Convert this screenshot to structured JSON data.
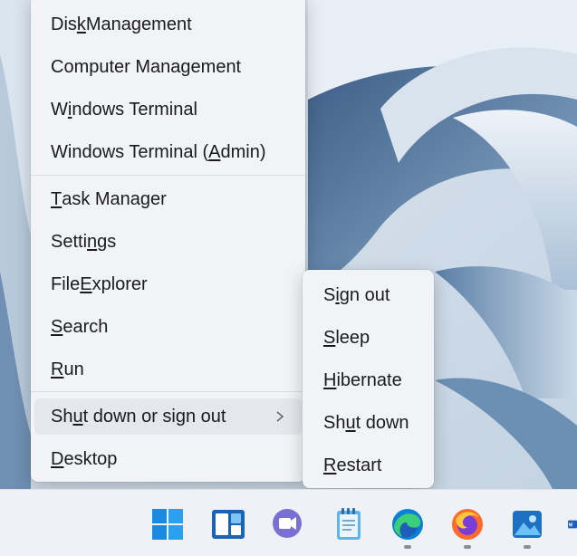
{
  "context_menu": {
    "items": [
      {
        "pre": "Dis",
        "u": "k",
        "post": " Management"
      },
      {
        "pre": "Computer Mana",
        "u": "g",
        "post": "ement"
      },
      {
        "pre": "W",
        "u": "i",
        "post": "ndows Terminal"
      },
      {
        "pre": "Windows Terminal (",
        "u": "A",
        "post": "dmin)"
      },
      {
        "pre": "",
        "u": "T",
        "post": "ask Manager"
      },
      {
        "pre": "Setti",
        "u": "n",
        "post": "gs"
      },
      {
        "pre": "File ",
        "u": "E",
        "post": "xplorer"
      },
      {
        "pre": "",
        "u": "S",
        "post": "earch"
      },
      {
        "pre": "",
        "u": "R",
        "post": "un"
      },
      {
        "pre": "Sh",
        "u": "u",
        "post": "t down or sign out"
      },
      {
        "pre": "",
        "u": "D",
        "post": "esktop"
      }
    ]
  },
  "submenu": {
    "items": [
      {
        "pre": "S",
        "u": "i",
        "post": "gn out"
      },
      {
        "pre": "",
        "u": "S",
        "post": "leep"
      },
      {
        "pre": "",
        "u": "H",
        "post": "ibernate"
      },
      {
        "pre": "Sh",
        "u": "u",
        "post": "t down"
      },
      {
        "pre": "",
        "u": "R",
        "post": "estart"
      }
    ]
  },
  "taskbar": {
    "icons": [
      "windows-start-icon",
      "widgets-icon",
      "teams-chat-icon",
      "notepad-icon",
      "edge-icon",
      "firefox-icon",
      "photos-icon",
      "word-icon"
    ],
    "running_indicators": [
      "edge-icon",
      "firefox-icon",
      "photos-icon"
    ]
  },
  "colors": {
    "menu_bg": "#f1f3f6",
    "highlight_bg": "#e4e7ec",
    "accent": "#0067c0"
  }
}
